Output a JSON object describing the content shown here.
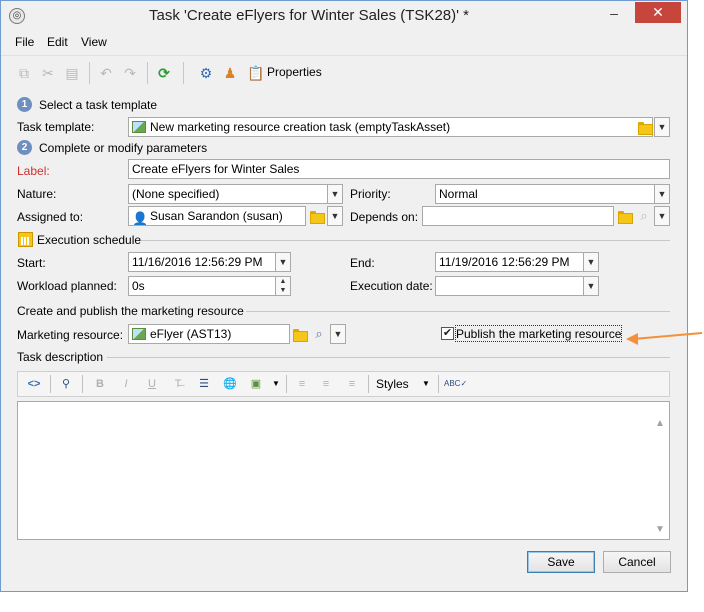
{
  "window": {
    "title": "Task 'Create eFlyers for Winter Sales (TSK28)' *",
    "minimize_symbol": "–",
    "close_symbol": "✕"
  },
  "menu": {
    "file": "File",
    "edit": "Edit",
    "view": "View"
  },
  "toolbar": {
    "properties_label": "Properties"
  },
  "step1": {
    "number": "1",
    "title": "Select a task template"
  },
  "task_template": {
    "label": "Task template:",
    "value": "New marketing resource creation task (emptyTaskAsset)"
  },
  "step2": {
    "number": "2",
    "title": "Complete or modify parameters"
  },
  "fields": {
    "label": {
      "label": "Label:",
      "value": "Create eFlyers for Winter Sales"
    },
    "nature": {
      "label": "Nature:",
      "value": "(None specified)"
    },
    "priority": {
      "label": "Priority:",
      "value": "Normal"
    },
    "assigned_to": {
      "label": "Assigned to:",
      "value": "Susan Sarandon (susan)"
    },
    "depends_on": {
      "label": "Depends on:",
      "value": ""
    }
  },
  "schedule": {
    "title": "Execution schedule",
    "start": {
      "label": "Start:",
      "value": "11/16/2016 12:56:29 PM"
    },
    "end": {
      "label": "End:",
      "value": "11/19/2016 12:56:29 PM"
    },
    "workload": {
      "label": "Workload planned:",
      "value": "0s"
    },
    "execution_date": {
      "label": "Execution date:",
      "value": ""
    }
  },
  "publish": {
    "title": "Create and publish the marketing resource",
    "resource_label": "Marketing resource:",
    "resource_value": "eFlyer (AST13)",
    "checkbox_label": "Publish the marketing resource",
    "checked": true
  },
  "description": {
    "label": "Task description",
    "styles_label": "Styles",
    "toolbar_icons": [
      "source-icon",
      "find-icon",
      "bold-icon",
      "italic-icon",
      "underline-icon",
      "clear-format-icon",
      "bullet-list-icon",
      "link-icon",
      "image-icon",
      "align-left-icon",
      "align-center-icon",
      "align-right-icon",
      "spellcheck-icon"
    ]
  },
  "buttons": {
    "save": "Save",
    "cancel": "Cancel"
  },
  "colors": {
    "close_button": "#c7463c",
    "label_required": "#d12e2e",
    "annotation_arrow": "#f4903a",
    "step_badge": "#6f8fbf"
  }
}
